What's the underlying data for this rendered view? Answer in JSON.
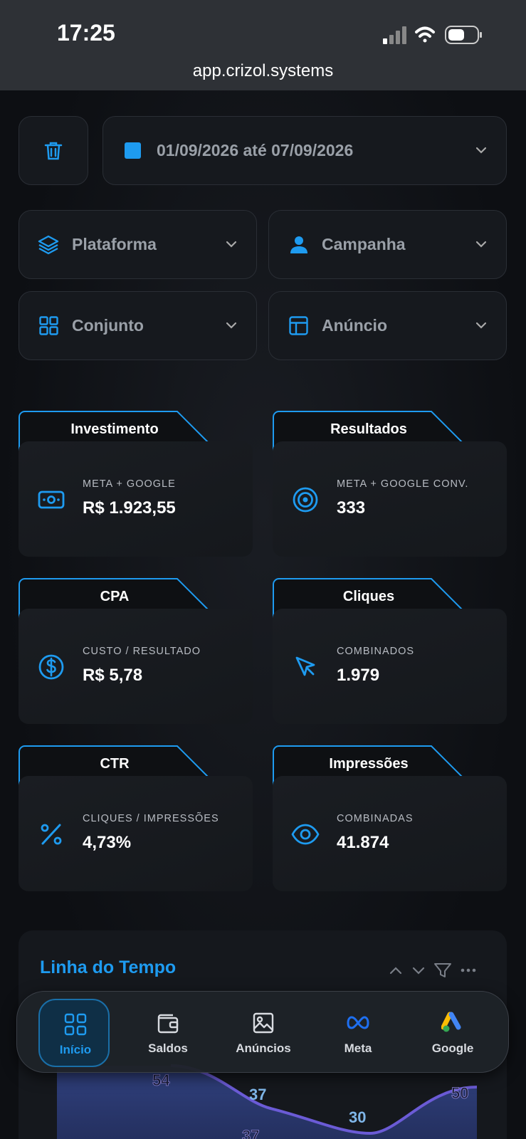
{
  "status": {
    "time": "17:25",
    "url": "app.crizol.systems"
  },
  "filters": {
    "date_range": "01/09/2026 até 07/09/2026",
    "platform": "Plataforma",
    "campaign": "Campanha",
    "adset": "Conjunto",
    "ad": "Anúncio"
  },
  "metrics": [
    {
      "title": "Investimento",
      "subtitle": "META + GOOGLE",
      "value": "R$ 1.923,55",
      "icon": "money-icon"
    },
    {
      "title": "Resultados",
      "subtitle": "META + GOOGLE CONV.",
      "value": "333",
      "icon": "target-icon"
    },
    {
      "title": "CPA",
      "subtitle": "CUSTO / RESULTADO",
      "value": "R$ 5,78",
      "icon": "dollar-icon"
    },
    {
      "title": "Cliques",
      "subtitle": "COMBINADOS",
      "value": "1.979",
      "icon": "cursor-icon"
    },
    {
      "title": "CTR",
      "subtitle": "CLIQUES / IMPRESSÕES",
      "value": "4,73%",
      "icon": "percent-icon"
    },
    {
      "title": "Impressões",
      "subtitle": "COMBINADAS",
      "value": "41.874",
      "icon": "eye-icon"
    }
  ],
  "timeline": {
    "title": "Linha do Tempo",
    "labels": [
      "54",
      "37",
      "37",
      "30",
      "50"
    ]
  },
  "nav": {
    "items": [
      {
        "label": "Início",
        "active": true
      },
      {
        "label": "Saldos",
        "active": false
      },
      {
        "label": "Anúncios",
        "active": false
      },
      {
        "label": "Meta",
        "active": false
      },
      {
        "label": "Google",
        "active": false
      }
    ]
  },
  "colors": {
    "accent": "#1e9bf0",
    "background": "#0c0e12",
    "card": "#16191e",
    "chart_line": "#6b5bd6"
  }
}
